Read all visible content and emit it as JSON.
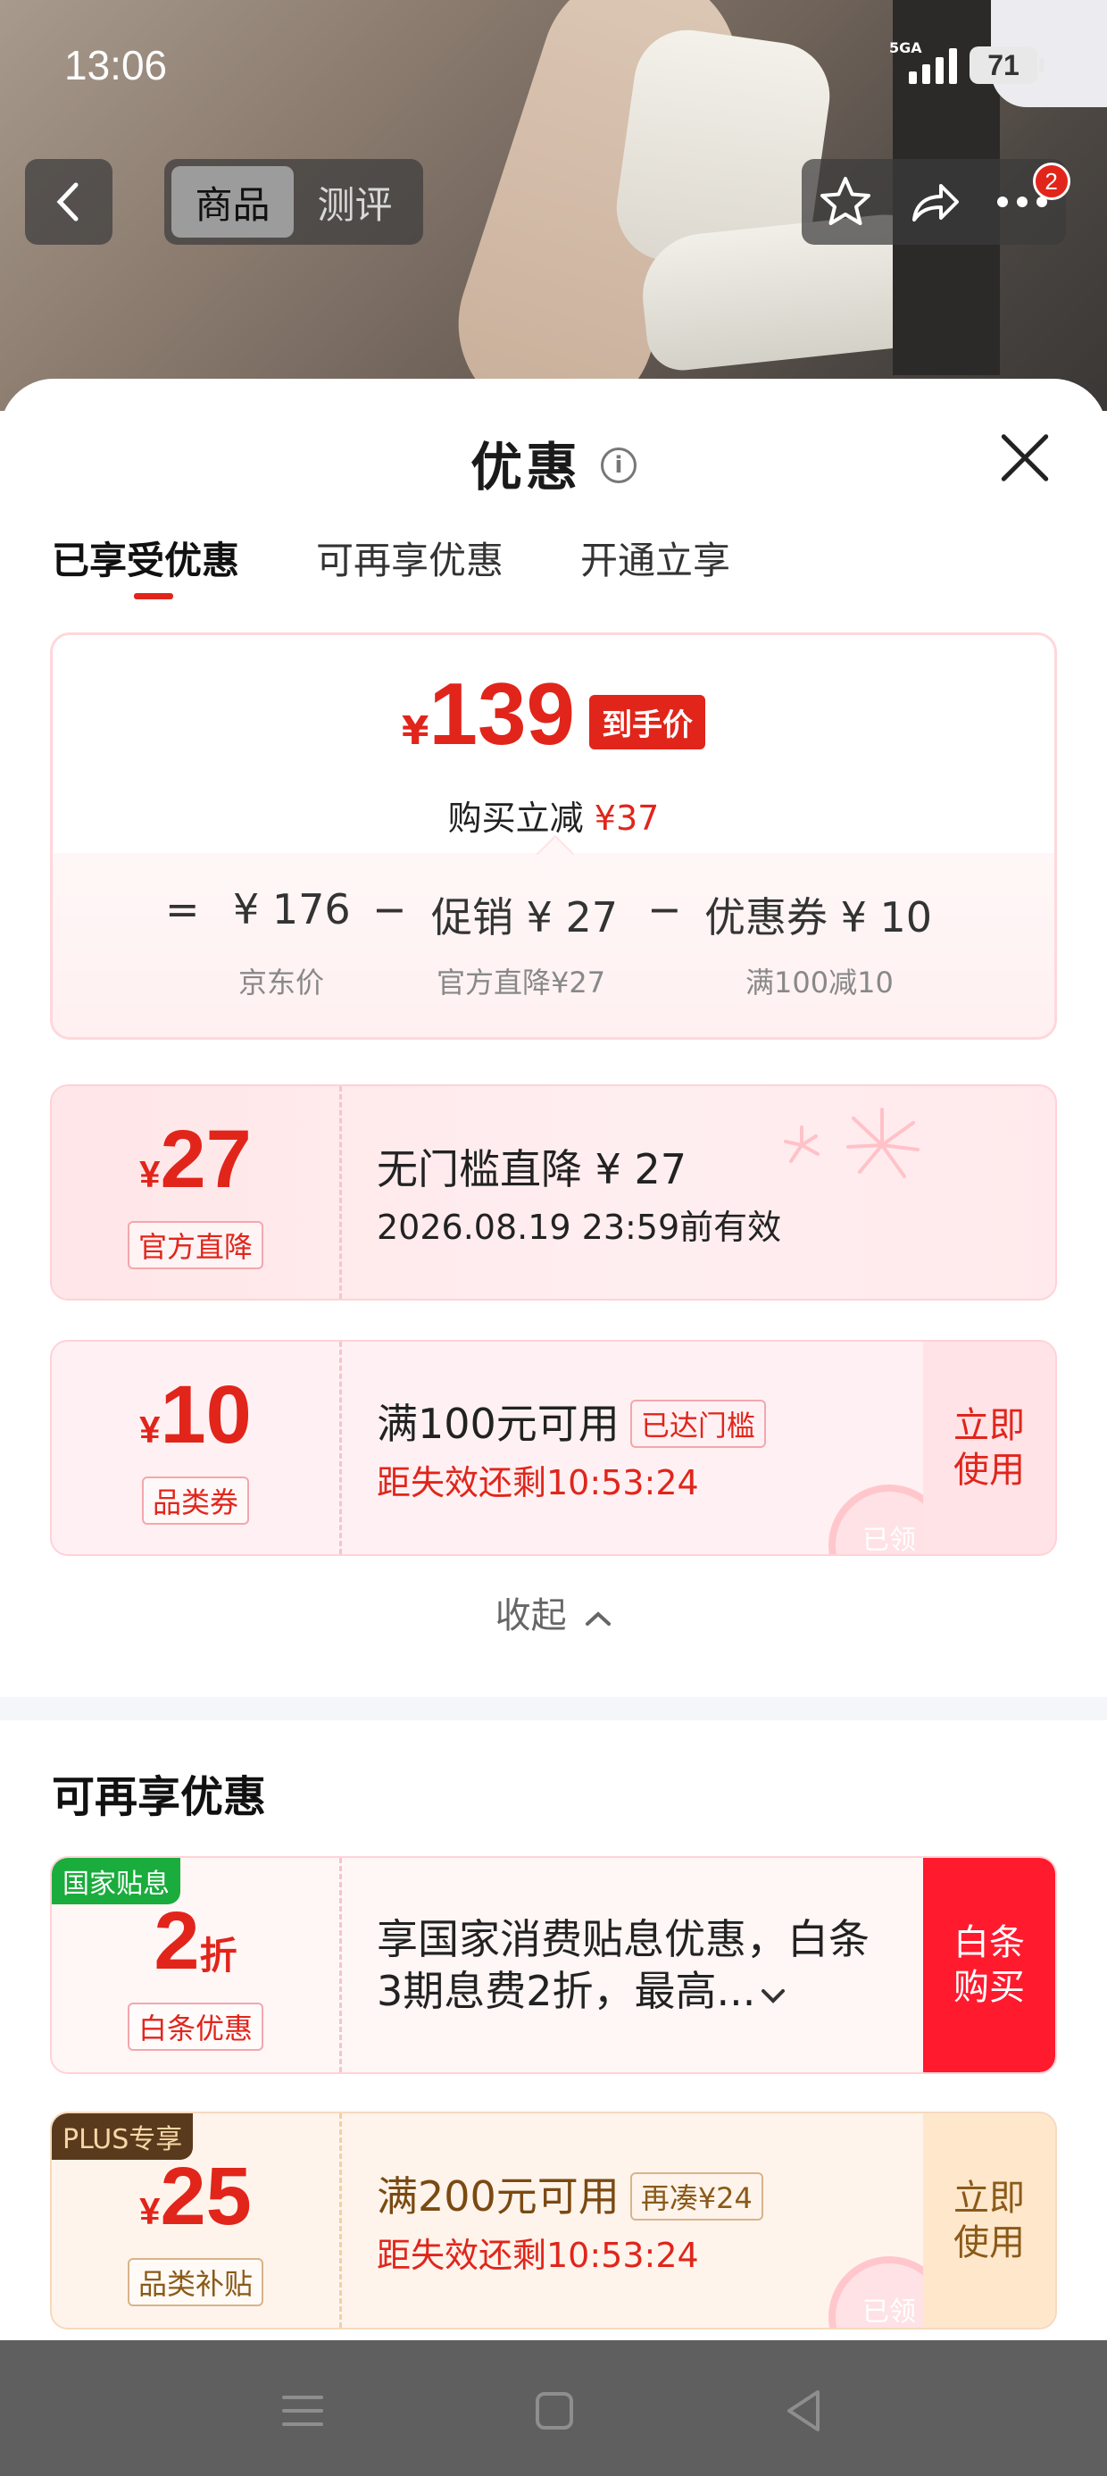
{
  "status_bar": {
    "time": "13:06",
    "network": "5GA",
    "battery": "71"
  },
  "nav": {
    "tabs": [
      "商品",
      "测评"
    ],
    "active_tab": "商品",
    "notification_count": "2"
  },
  "sheet": {
    "title": "优惠",
    "info_icon": "i",
    "tabs": [
      "已享受优惠",
      "可再享优惠",
      "开通立享"
    ],
    "active_tab": "已享受优惠"
  },
  "summary": {
    "currency": "¥",
    "final_price": "139",
    "final_tag": "到手价",
    "save_prefix": "购买立减",
    "save_amount": "¥37",
    "eq": "=",
    "minus": "−",
    "items": [
      {
        "value": "¥ 176",
        "sub": "京东价"
      },
      {
        "value": "促销 ¥ 27",
        "sub": "官方直降¥27"
      },
      {
        "value": "优惠券 ¥ 10",
        "sub": "满100减10"
      }
    ]
  },
  "enjoyed": [
    {
      "currency": "¥",
      "amount": "27",
      "label": "官方直降",
      "line1": "无门槛直降 ¥ 27",
      "line2": "2026.08.19 23:59前有效"
    },
    {
      "currency": "¥",
      "amount": "10",
      "label": "品类券",
      "line1": "满100元可用",
      "pill": "已达门槛",
      "line2": "距失效还剩10:53:24",
      "action": "立即使用",
      "stamp": "已领"
    }
  ],
  "collapse_label": "收起",
  "more_section": {
    "title": "可再享优惠",
    "offers": [
      {
        "corner": "国家贴息",
        "amount": "2",
        "unit": "折",
        "label": "白条优惠",
        "text": "享国家消费贴息优惠，白条3期息费2折，最高...",
        "action": "白条购买"
      },
      {
        "corner": "PLUS专享",
        "currency": "¥",
        "amount": "25",
        "label": "品类补贴",
        "line1": "满200元可用",
        "pill": "再凑¥24",
        "line2": "距失效还剩10:53:24",
        "action": "立即使用",
        "stamp": "已领"
      }
    ]
  },
  "colors": {
    "accent": "#e1251b",
    "plus_gold": "#8a5a18",
    "subsidy_green": "#1aac3c"
  }
}
